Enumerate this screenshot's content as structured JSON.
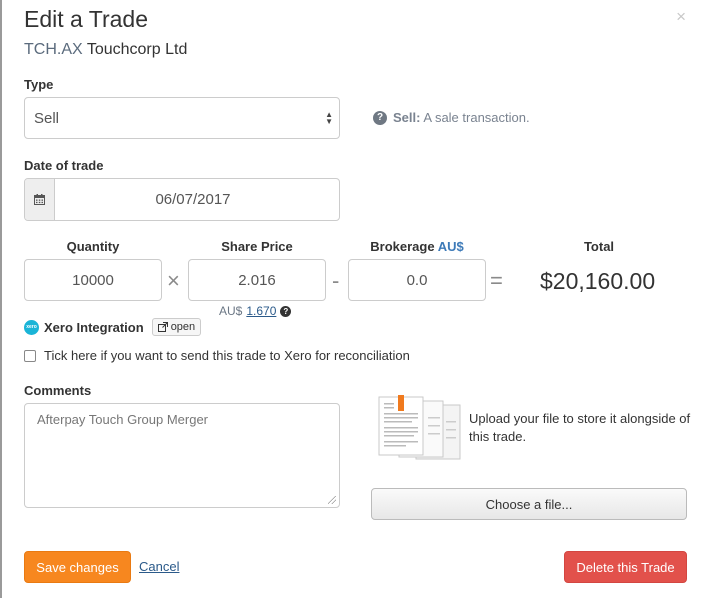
{
  "dialog": {
    "title": "Edit a Trade",
    "close": "×",
    "ticker": "TCH.AX",
    "company": "Touchcorp Ltd"
  },
  "type": {
    "label": "Type",
    "value": "Sell",
    "help_term": "Sell:",
    "help_text": "A sale transaction."
  },
  "date": {
    "label": "Date of trade",
    "value": "06/07/2017",
    "icon": "calendar-icon"
  },
  "trade": {
    "quantity_label": "Quantity",
    "quantity": "10000",
    "multiply": "×",
    "price_label": "Share Price",
    "price": "2.016",
    "minus": "-",
    "brokerage_label": "Brokerage",
    "brokerage_currency": "AU$",
    "brokerage": "0.0",
    "equals": "=",
    "total_label": "Total",
    "total": "$20,160.00",
    "aud_prefix": "AU$",
    "aud_value": "1.670"
  },
  "xero": {
    "logo_text": "xero",
    "title": "Xero Integration",
    "open_label": "open",
    "checkbox_label": "Tick here if you want to send this trade to Xero for reconciliation",
    "checked": false
  },
  "comments": {
    "label": "Comments",
    "value": "Afterpay Touch Group Merger"
  },
  "upload": {
    "text": "Upload your file to store it alongside of this trade.",
    "button": "Choose a file..."
  },
  "actions": {
    "save": "Save changes",
    "cancel": "Cancel",
    "delete": "Delete this Trade"
  },
  "colors": {
    "save": "#f7871f",
    "delete": "#e2514b",
    "link": "#2b5a8a",
    "xero": "#1ab4d7"
  }
}
